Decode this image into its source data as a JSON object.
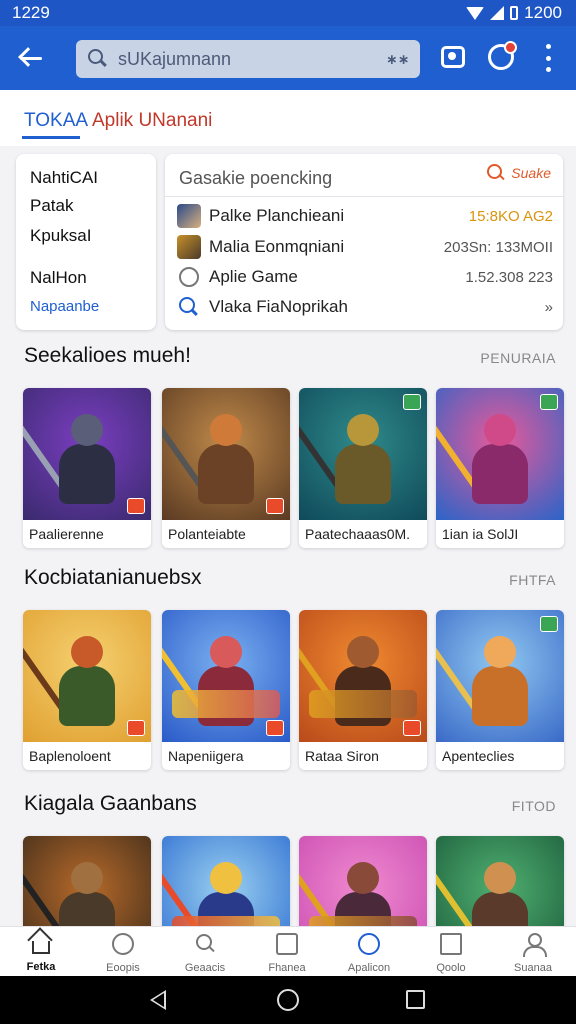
{
  "status_bar": {
    "time": "1229",
    "time_right": "1200"
  },
  "search": {
    "placeholder": "sUKajumnann"
  },
  "tabs": [
    {
      "label": "TOKAA"
    },
    {
      "label": "Aplik UNanani"
    }
  ],
  "categories": [
    {
      "label": "NahtiCAI"
    },
    {
      "label": "Patak"
    },
    {
      "label": "KpuksaI"
    },
    {
      "label": "NalHon"
    },
    {
      "label": "Napaanbe"
    }
  ],
  "ranking": {
    "title": "Gasakie poencking",
    "more_label": "Suake",
    "rows": [
      {
        "name": "Palke Planchieani",
        "value": "15:8KO AG2",
        "icon": "avatar-thumbnail",
        "accent": true
      },
      {
        "name": "Malia Eonmqniani",
        "value": "203Sn: 133MOII",
        "icon": "avatar-thumbnail",
        "accent": false
      },
      {
        "name": "Aplie Game",
        "value": "1.52.308 223",
        "icon": "radio-circle-icon",
        "accent": false
      },
      {
        "name": "Vlaka FiaNoprikah",
        "value": "»",
        "icon": "search-icon",
        "accent": false
      }
    ]
  },
  "sections": [
    {
      "title": "Seekalioes mueh!",
      "more": "PENURAIA",
      "tiles": [
        {
          "label": "Paalierenne",
          "bg": [
            "#3a2a6e",
            "#7a3ec0"
          ],
          "fig": "#2c2f44",
          "head": "#5a5e78",
          "weapon": "#9aa0b4"
        },
        {
          "label": "Polanteiabte",
          "bg": [
            "#5a3a22",
            "#c08a4a"
          ],
          "fig": "#6b4226",
          "head": "#d07a3a",
          "weapon": "#555"
        },
        {
          "label": "Paatechaaas0M.",
          "bg": [
            "#0f4a5a",
            "#2f8a8a"
          ],
          "fig": "#6a5a2a",
          "head": "#b8963a",
          "weapon": "#333"
        },
        {
          "label": "1ian ia SolJI",
          "bg": [
            "#2a64c8",
            "#e85a9a"
          ],
          "fig": "#8a2a6a",
          "head": "#d04a8a",
          "weapon": "#f0b030"
        }
      ]
    },
    {
      "title": "Kocbiatanianuebsx",
      "more": "FHTFA",
      "tiles": [
        {
          "label": "Baplenoloent",
          "bg": [
            "#e0a030",
            "#f5d070"
          ],
          "fig": "#3a5a2a",
          "head": "#c85a2a",
          "weapon": "#6a3a1a"
        },
        {
          "label": "Napeniigera",
          "bg": [
            "#2a5ac8",
            "#7ab0f0"
          ],
          "fig": "#8a2a3a",
          "head": "#d85a5a",
          "weapon": "#f0c030"
        },
        {
          "label": "Rataa Siron",
          "bg": [
            "#b84a1a",
            "#f08a30"
          ],
          "fig": "#4a2a1a",
          "head": "#a05a30",
          "weapon": "#e0a020"
        },
        {
          "label": "Apenteclies",
          "bg": [
            "#3a6ac8",
            "#90c8f0"
          ],
          "fig": "#c8702a",
          "head": "#f0a85a",
          "weapon": "#e8c050"
        }
      ]
    },
    {
      "title": "Kiagala Gaanbans",
      "more": "FITOD",
      "tiles": [
        {
          "label": "",
          "bg": [
            "#3a2a1a",
            "#b86a2a"
          ],
          "fig": "#4a3a2a",
          "head": "#a07040",
          "weapon": "#222"
        },
        {
          "label": "",
          "bg": [
            "#2a6ad0",
            "#9ad0f0"
          ],
          "fig": "#2a3a8a",
          "head": "#f0c040",
          "weapon": "#e84a2a"
        },
        {
          "label": "",
          "bg": [
            "#c84ab0",
            "#f08ad0"
          ],
          "fig": "#4a2a3a",
          "head": "#8a4a3a",
          "weapon": "#e0a020"
        },
        {
          "label": "",
          "bg": [
            "#1a5a3a",
            "#50b070"
          ],
          "fig": "#5a3a2a",
          "head": "#d09050",
          "weapon": "#e0c030"
        }
      ]
    }
  ],
  "bottom_nav": [
    {
      "label": "Fetka",
      "icon": "home-icon"
    },
    {
      "label": "Eoopis",
      "icon": "smile-icon"
    },
    {
      "label": "Geaacis",
      "icon": "search-icon"
    },
    {
      "label": "Fhanea",
      "icon": "grid-icon"
    },
    {
      "label": "Apalicon",
      "icon": "apps-icon"
    },
    {
      "label": "Qoolo",
      "icon": "square-icon"
    },
    {
      "label": "Suanaa",
      "icon": "person-icon"
    }
  ]
}
